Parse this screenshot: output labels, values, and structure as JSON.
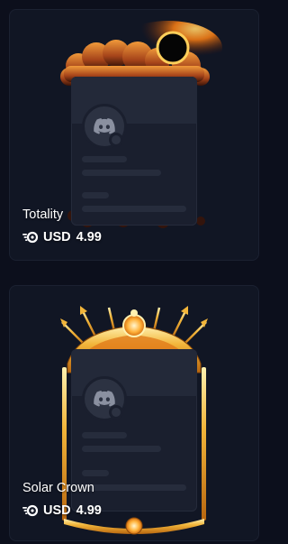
{
  "items": [
    {
      "name": "Totality",
      "currency": "USD",
      "price": "4.99",
      "icon": "nitro-icon"
    },
    {
      "name": "Solar Crown",
      "currency": "USD",
      "price": "4.99",
      "icon": "nitro-icon"
    }
  ],
  "colors": {
    "background": "#0c0f1c",
    "card": "#111624",
    "card_border": "#1b2131",
    "placeholder": "#1a1f2e",
    "eclipse_glow": "#ff9a1a",
    "crown_gold": "#f2b53a"
  }
}
